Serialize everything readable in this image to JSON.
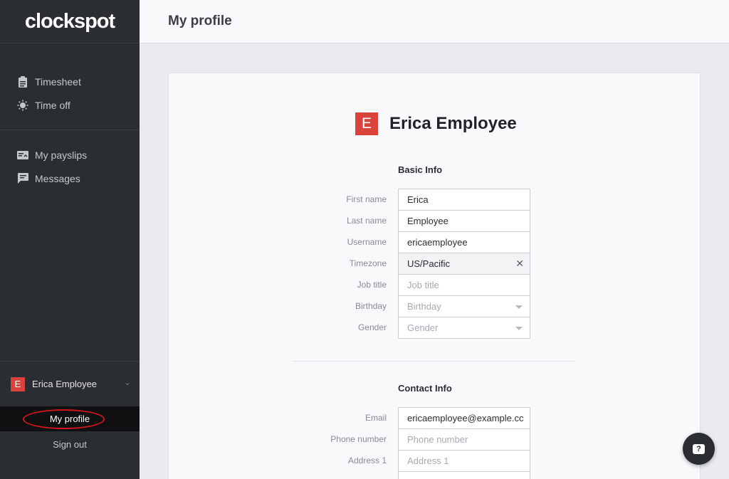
{
  "app": {
    "logo_text": "clockspot"
  },
  "sidebar": {
    "items": [
      {
        "label": "Timesheet",
        "icon": "clipboard-icon"
      },
      {
        "label": "Time off",
        "icon": "sun-icon"
      },
      {
        "label": "My payslips",
        "icon": "payslip-icon"
      },
      {
        "label": "Messages",
        "icon": "chat-icon"
      }
    ],
    "user": {
      "initial": "E",
      "name": "Erica Employee"
    },
    "my_profile_label": "My profile",
    "sign_out_label": "Sign out"
  },
  "header": {
    "title": "My profile"
  },
  "profile": {
    "initial": "E",
    "name": "Erica Employee",
    "basic_info": {
      "title": "Basic Info",
      "fields": [
        {
          "label": "First name",
          "value": "Erica",
          "placeholder": ""
        },
        {
          "label": "Last name",
          "value": "Employee",
          "placeholder": ""
        },
        {
          "label": "Username",
          "value": "ericaemployee",
          "placeholder": ""
        },
        {
          "label": "Timezone",
          "value": "US/Pacific",
          "placeholder": ""
        },
        {
          "label": "Job title",
          "value": "",
          "placeholder": "Job title"
        },
        {
          "label": "Birthday",
          "value": "",
          "placeholder": "Birthday"
        },
        {
          "label": "Gender",
          "value": "",
          "placeholder": "Gender"
        }
      ]
    },
    "contact_info": {
      "title": "Contact Info",
      "fields": [
        {
          "label": "Email",
          "value": "ericaemployee@example.cc",
          "placeholder": ""
        },
        {
          "label": "Phone number",
          "value": "",
          "placeholder": "Phone number"
        },
        {
          "label": "Address 1",
          "value": "",
          "placeholder": "Address 1"
        }
      ]
    }
  },
  "colors": {
    "accent": "#d9433b",
    "sidebar_bg": "#2a2d31",
    "highlight_ring": "#d3161b"
  }
}
